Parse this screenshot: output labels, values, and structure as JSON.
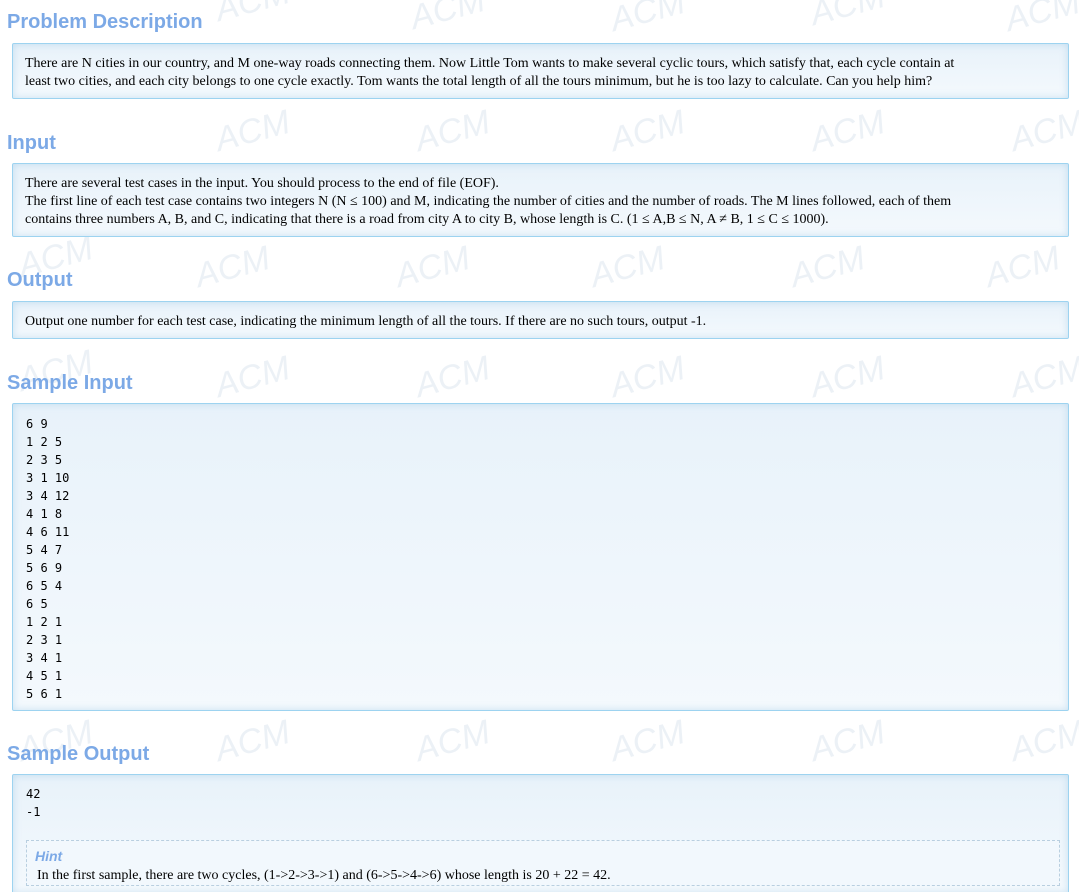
{
  "watermark_text": "ACM",
  "sections": {
    "problem_description": {
      "title": "Problem Description",
      "text": "There are N cities in our country, and M one-way roads connecting them. Now Little Tom wants to make several cyclic tours, which satisfy that, each cycle contain at\nleast two cities, and each city belongs to one cycle exactly. Tom wants the total length of all the tours minimum, but he is too lazy to calculate. Can you help him?"
    },
    "input": {
      "title": "Input",
      "text": "There are several test cases in the input. You should process to the end of file (EOF).\nThe first line of each test case contains two integers N (N ≤ 100) and M, indicating the number of cities and the number of roads. The M lines followed, each of them\ncontains three numbers A, B, and C, indicating that there is a road from city A to city B, whose length is C. (1 ≤ A,B ≤ N, A ≠ B, 1 ≤ C ≤ 1000)."
    },
    "output": {
      "title": "Output",
      "text": "Output one number for each test case, indicating the minimum length of all the tours. If there are no such tours, output -1."
    },
    "sample_input": {
      "title": "Sample Input",
      "text": "6 9\n1 2 5\n2 3 5\n3 1 10\n3 4 12\n4 1 8\n4 6 11\n5 4 7\n5 6 9\n6 5 4\n6 5\n1 2 1\n2 3 1\n3 4 1\n4 5 1\n5 6 1"
    },
    "sample_output": {
      "title": "Sample Output",
      "text": "42\n-1",
      "hint_label": "Hint",
      "hint_text": "In the first sample, there are two cycles, (1->2->3->1) and (6->5->4->6) whose length is 20 + 22 = 42."
    }
  },
  "colors": {
    "title": "#7ca9e6",
    "panel_border": "#9dd3f0",
    "panel_bg": "#e8f2fa"
  }
}
